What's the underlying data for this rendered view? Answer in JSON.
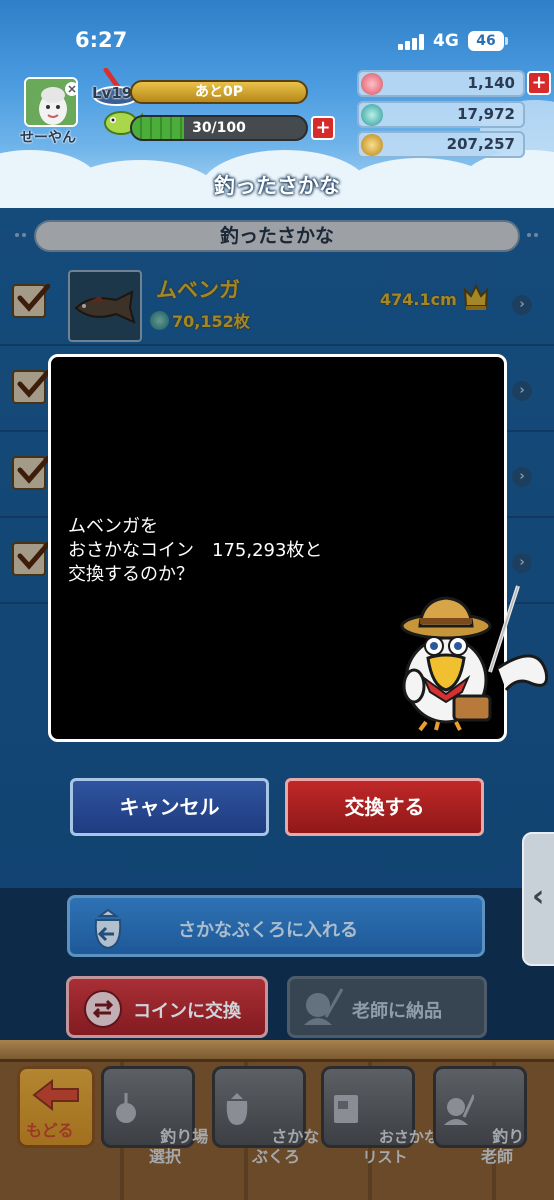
{
  "status_bar": {
    "time": "6:27",
    "network": "4G",
    "battery": "46"
  },
  "player": {
    "name": "せーやん",
    "level": "Lv19",
    "exp_text": "あと0P",
    "stamina_text": "30/100",
    "stamina_fraction": 0.3
  },
  "currencies": [
    {
      "icon": "gem-icon",
      "value": "1,140",
      "color": "#e8707a"
    },
    {
      "icon": "fish-coin-icon",
      "value": "17,972",
      "color": "#3aa8a8"
    },
    {
      "icon": "gold-coin-icon",
      "value": "207,257",
      "color": "#d8a020"
    }
  ],
  "screen_title": "釣ったさかな",
  "list": {
    "header": "釣ったさかな",
    "first_fish": {
      "name": "ムベンガ",
      "coins": "70,152枚",
      "size": "474.1cm"
    }
  },
  "dialog": {
    "message": "ムベンガを\nおさかなコイン　175,293枚と\n交換するのか？"
  },
  "buttons": {
    "cancel": "キャンセル",
    "exchange": "交換する",
    "put_in_bag": "さかなぶくろに入れる",
    "exchange_coin": "コインに交換",
    "deliver_teacher": "老師に納品"
  },
  "nav": {
    "back": "もどる",
    "fishing_spot": "釣り場\n選択",
    "fish_bag": "さかな\nぶくろ",
    "fish_list": "おさかな\nリスト",
    "fishing_teacher": "釣り\n老師"
  },
  "colors": {
    "accent_red": "#c02828",
    "accent_blue": "#3054a0",
    "gold_text": "#f0c838"
  }
}
